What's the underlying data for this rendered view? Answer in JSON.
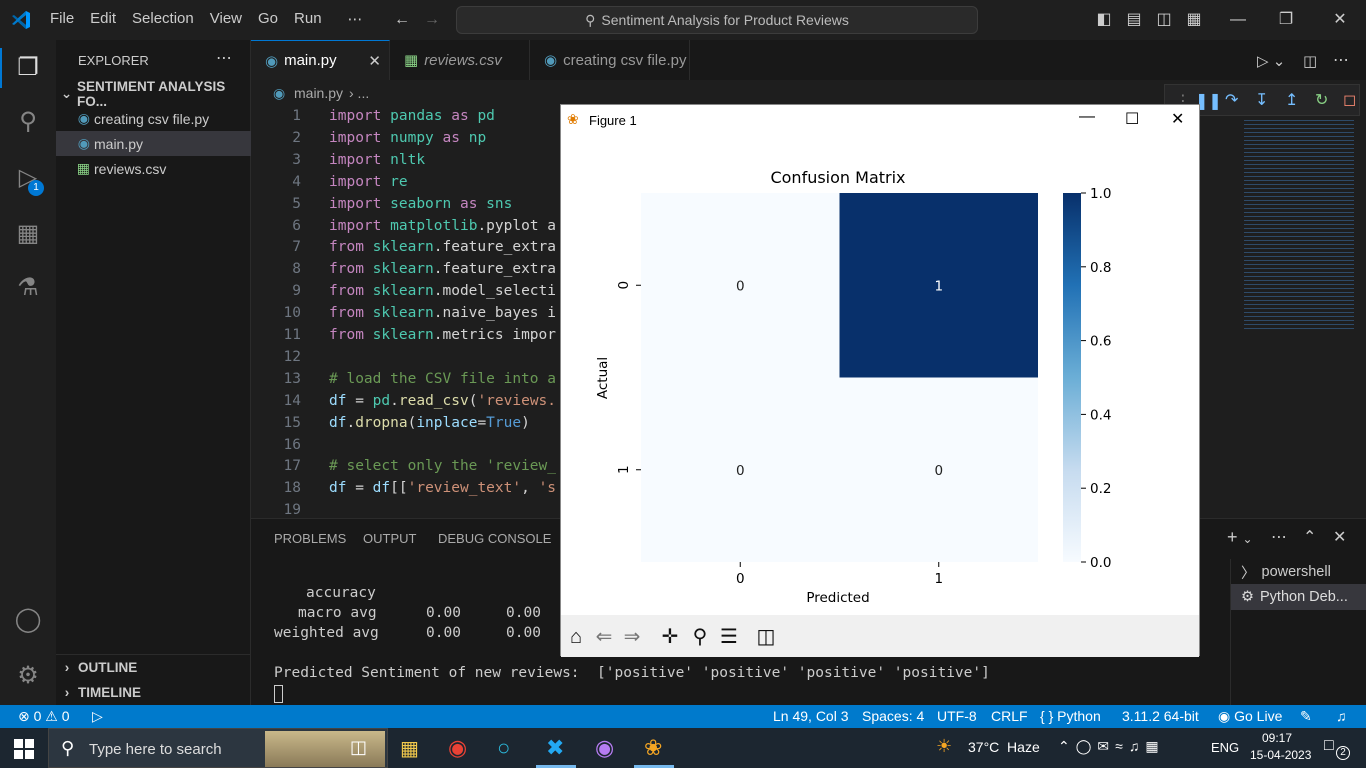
{
  "titlebar": {
    "menus": [
      "File",
      "Edit",
      "Selection",
      "View",
      "Go",
      "Run",
      "⋯"
    ],
    "search_text": "Sentiment Analysis for Product Reviews"
  },
  "activity": {
    "debug_badge": "1"
  },
  "sidebar": {
    "header": "EXPLORER",
    "folder": "SENTIMENT ANALYSIS FO...",
    "files": [
      "creating csv file.py",
      "main.py",
      "reviews.csv"
    ],
    "outline": "OUTLINE",
    "timeline": "TIMELINE"
  },
  "tabs": [
    "main.py",
    "reviews.csv",
    "creating csv file.py"
  ],
  "breadcrumb": {
    "file": "main.py",
    "sep": "› ..."
  },
  "code": {
    "line_numbers": [
      "1",
      "2",
      "3",
      "4",
      "5",
      "6",
      "7",
      "8",
      "9",
      "10",
      "11",
      "12",
      "13",
      "14",
      "15",
      "16",
      "17",
      "18",
      "19"
    ],
    "lines": [
      "import pandas as pd",
      "import numpy as np",
      "import nltk",
      "import re",
      "import seaborn as sns",
      "import matplotlib.pyplot a",
      "from sklearn.feature_extra",
      "from sklearn.feature_extra",
      "from sklearn.model_selecti",
      "from sklearn.naive_bayes i",
      "from sklearn.metrics impor",
      "",
      "# load the CSV file into a",
      "df = pd.read_csv('reviews.",
      "df.dropna(inplace=True)",
      "",
      "# select only the 'review_",
      "df = df[['review_text', 's",
      ""
    ]
  },
  "panel": {
    "tabs": [
      "PROBLEMS",
      "OUTPUT",
      "DEBUG CONSOLE"
    ],
    "report_rows": [
      {
        "label": "accuracy",
        "v1": "",
        "v2": ""
      },
      {
        "label": "macro avg",
        "v1": "0.00",
        "v2": "0.00"
      },
      {
        "label": "weighted avg",
        "v1": "0.00",
        "v2": "0.00"
      }
    ],
    "prediction_line": "Predicted Sentiment of new reviews:  ['positive' 'positive' 'positive' 'positive']",
    "terminals": [
      "powershell",
      "Python Deb..."
    ]
  },
  "statusbar": {
    "errors": "0",
    "warnings": "0",
    "position": "Ln 49, Col 3",
    "spaces": "Spaces: 4",
    "encoding": "UTF-8",
    "eol": "CRLF",
    "language": "Python",
    "interpreter": "3.11.2 64-bit",
    "golive": "Go Live"
  },
  "taskbar": {
    "search_placeholder": "Type here to search",
    "weather": "37°C  Haze",
    "lang": "ENG",
    "time": "09:17",
    "date": "15-04-2023",
    "notifications": "2"
  },
  "figure": {
    "window_title": "Figure 1"
  },
  "chart_data": {
    "type": "heatmap",
    "title": "Confusion Matrix",
    "xlabel": "Predicted",
    "ylabel": "Actual",
    "x_categories": [
      "0",
      "1"
    ],
    "y_categories": [
      "0",
      "1"
    ],
    "values": [
      [
        0,
        1
      ],
      [
        0,
        0
      ]
    ],
    "colorbar": {
      "min": 0.0,
      "max": 1.0,
      "ticks": [
        "0.0",
        "0.2",
        "0.4",
        "0.6",
        "0.8",
        "1.0"
      ]
    },
    "colormap": {
      "low": "#f7fbff",
      "high": "#08306b"
    }
  }
}
